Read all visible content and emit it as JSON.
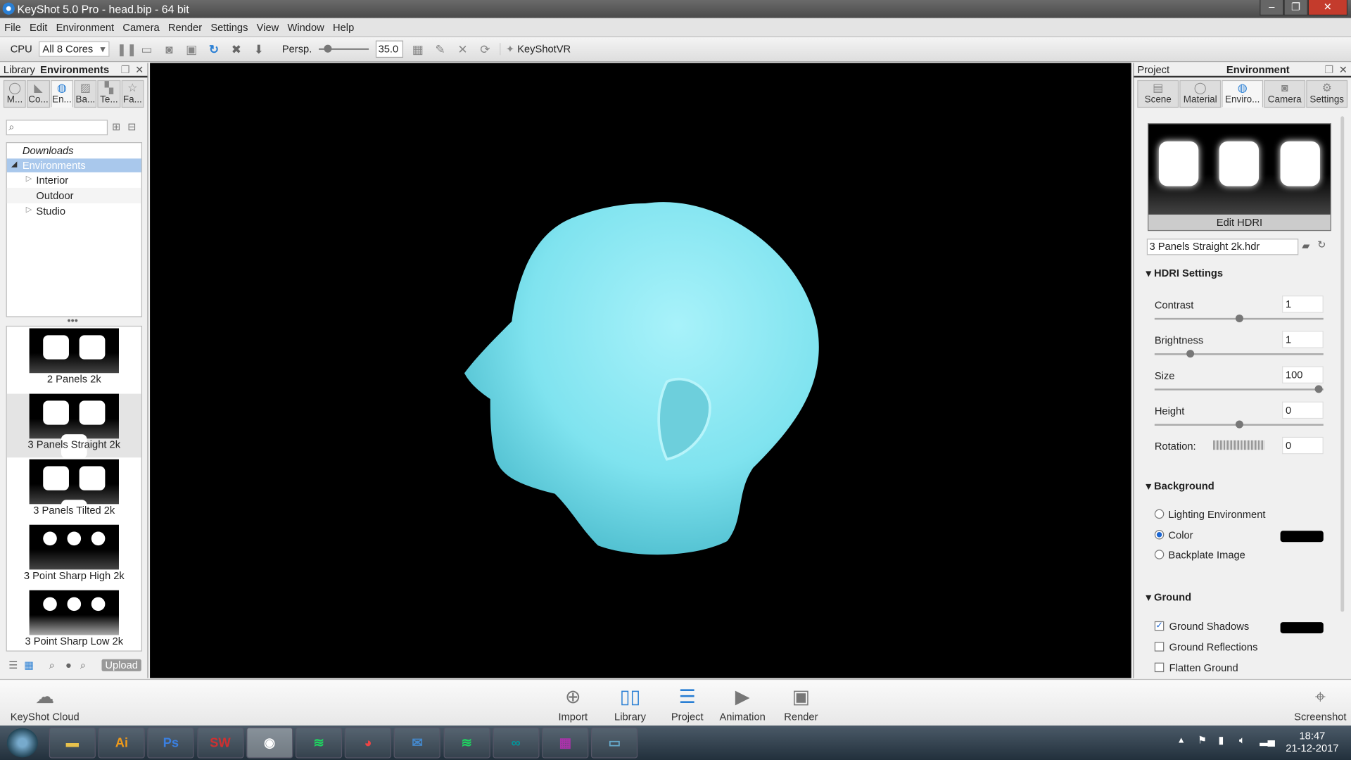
{
  "window": {
    "title": "KeyShot 5.0 Pro  - head.bip  - 64 bit"
  },
  "menu": [
    "File",
    "Edit",
    "Environment",
    "Camera",
    "Render",
    "Settings",
    "View",
    "Window",
    "Help"
  ],
  "toolbar": {
    "cpu_label": "CPU",
    "cores": "All 8 Cores",
    "persp_label": "Persp.",
    "fov": "35.0",
    "vr_label": "KeyShotVR"
  },
  "library": {
    "title_prefix": "Library",
    "title": "Environments",
    "tabs": [
      "M...",
      "Co...",
      "En...",
      "Ba...",
      "Te...",
      "Fa..."
    ],
    "search_placeholder": "",
    "tree": {
      "downloads": "Downloads",
      "root": "Environments",
      "children": [
        "Interior",
        "Outdoor",
        "Studio"
      ]
    },
    "thumbs": [
      "2 Panels 2k",
      "3 Panels Straight 2k",
      "3 Panels Tilted 2k",
      "3 Point Sharp High 2k",
      "3 Point Sharp Low 2k"
    ],
    "upload": "Upload"
  },
  "project": {
    "title_prefix": "Project",
    "title": "Environment",
    "tabs": [
      "Scene",
      "Material",
      "Enviro...",
      "Camera",
      "Settings"
    ],
    "edit_hdri": "Edit HDRI",
    "hdri_file": "3 Panels Straight 2k.hdr",
    "hdri_section": "HDRI Settings",
    "contrast": {
      "label": "Contrast",
      "value": "1"
    },
    "brightness": {
      "label": "Brightness",
      "value": "1"
    },
    "size": {
      "label": "Size",
      "value": "100"
    },
    "height": {
      "label": "Height",
      "value": "0"
    },
    "rotation": {
      "label": "Rotation:",
      "value": "0"
    },
    "background_section": "Background",
    "bg_options": [
      "Lighting Environment",
      "Color",
      "Backplate Image"
    ],
    "bg_selected": "Color",
    "bg_color": "#000000",
    "ground_section": "Ground",
    "ground": [
      {
        "label": "Ground Shadows",
        "checked": true
      },
      {
        "label": "Ground Reflections",
        "checked": false
      },
      {
        "label": "Flatten Ground",
        "checked": false
      }
    ],
    "shadow_color": "#000000"
  },
  "bottombar": {
    "cloud": "KeyShot Cloud",
    "buttons": [
      "Import",
      "Library",
      "Project",
      "Animation",
      "Render"
    ],
    "screenshot": "Screenshot"
  },
  "taskbar": {
    "apps": [
      "Explorer",
      "Illustrator",
      "Photoshop",
      "SolidWorks 2016",
      "KeyShot",
      "Spotify",
      "Chrome",
      "Thunderbird",
      "Spotify",
      "Arduino",
      "WinRAR",
      "Photos"
    ],
    "time": "18:47",
    "date": "21-12-2017"
  },
  "colors": {
    "accent": "#1b66d2",
    "model": "#7fe3ef"
  }
}
